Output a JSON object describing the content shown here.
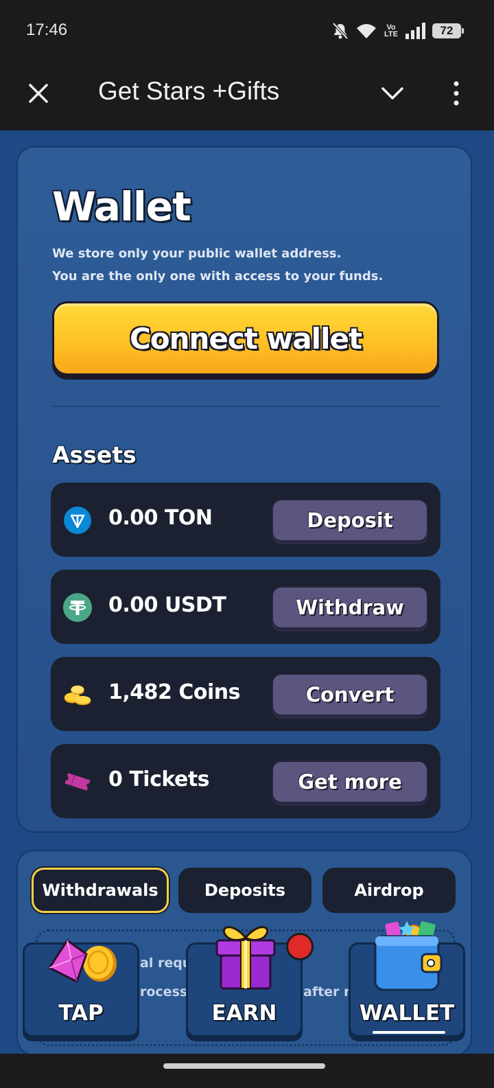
{
  "status_bar": {
    "time": "17:46",
    "volte_top": "Vo",
    "volte_bottom": "LTE",
    "battery": "72",
    "icons": [
      "bell-off-icon",
      "wifi-icon",
      "signal-icon",
      "battery-icon"
    ]
  },
  "title_bar": {
    "title": "Get Stars +Gifts",
    "icons": [
      "close-icon",
      "chevron-down-icon",
      "more-vertical-icon"
    ]
  },
  "wallet": {
    "title": "Wallet",
    "description_line1": "We store only your public wallet address.",
    "description_line2": "You are the only one with access to your funds.",
    "connect_label": "Connect wallet"
  },
  "assets": {
    "heading": "Assets",
    "items": [
      {
        "icon": "ton-icon",
        "amount": "0.00 TON",
        "action": "Deposit"
      },
      {
        "icon": "usdt-icon",
        "amount": "0.00 USDT",
        "action": "Withdraw"
      },
      {
        "icon": "coins-icon",
        "amount": "1,482 Coins",
        "action": "Convert"
      },
      {
        "icon": "ticket-icon",
        "amount": "0 Tickets",
        "action": "Get more"
      }
    ]
  },
  "history": {
    "tabs": [
      "Withdrawals",
      "Deposits",
      "Airdrop"
    ],
    "active_tab": "Withdrawals",
    "text_fragments": [
      "al reque",
      "rocesse",
      "after re"
    ]
  },
  "bottom_nav": {
    "items": [
      {
        "label": "TAP",
        "icon": "gem-coin-icon"
      },
      {
        "label": "EARN",
        "icon": "gift-icon"
      },
      {
        "label": "WALLET",
        "icon": "wallet-icon"
      }
    ],
    "active": "WALLET"
  },
  "colors": {
    "background": "#1d4a85",
    "card": "#2e5d98",
    "row": "#1b2130",
    "accent_yellow": "#ffc629",
    "button_purple": "#5b5680",
    "notification": "#e02a2a"
  }
}
